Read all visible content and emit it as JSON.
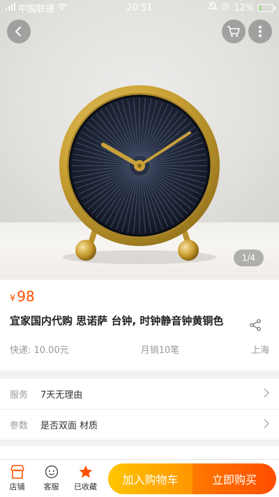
{
  "status_bar": {
    "carrier": "中国联通",
    "time": "20:51",
    "battery": "12%",
    "battery_level": 0.12
  },
  "gallery": {
    "page_indicator": "1/4"
  },
  "product": {
    "currency": "¥",
    "price": "98",
    "title": "宜家国内代购 思诺萨 台钟, 时钟静音钟黄铜色",
    "shipping": "快递: 10.00元",
    "monthly_sales": "月销10笔",
    "location": "上海"
  },
  "rows": [
    {
      "label": "服务",
      "value": "7天无理由"
    },
    {
      "label": "参数",
      "value": "是否双面 材质"
    }
  ],
  "bottom_bar": {
    "shop_label": "店铺",
    "service_label": "客服",
    "favorite_label": "已收藏",
    "add_to_cart": "加入购物车",
    "buy_now": "立即购买"
  },
  "colors": {
    "accent": "#ff5000",
    "cart_button": "#ffa200",
    "buy_button": "#ff5a00",
    "favorite_star": "#ff5000"
  },
  "icons": [
    "wifi-icon",
    "back-arrow-icon",
    "cart-icon",
    "more-vertical-icon",
    "share-icon",
    "chevron-right-icon",
    "shop-icon",
    "customer-service-icon",
    "star-icon"
  ]
}
